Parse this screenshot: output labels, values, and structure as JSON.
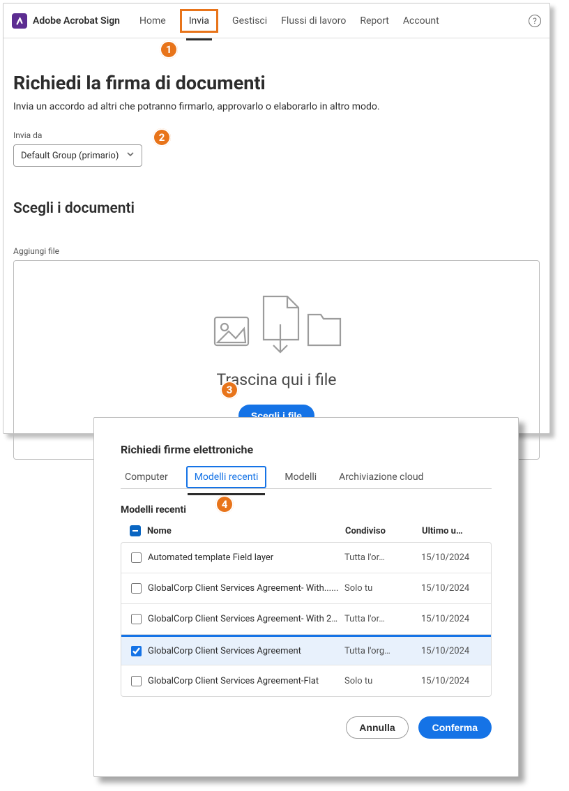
{
  "brand": "Adobe Acrobat Sign",
  "nav": {
    "items": [
      {
        "label": "Home"
      },
      {
        "label": "Invia"
      },
      {
        "label": "Gestisci"
      },
      {
        "label": "Flussi di lavoro"
      },
      {
        "label": "Report"
      },
      {
        "label": "Account"
      }
    ],
    "active_index": 1
  },
  "page": {
    "title": "Richiedi la firma di documenti",
    "subtitle": "Invia un accordo ad altri che potranno firmarlo, approvarlo o elaborarlo in altro modo.",
    "send_from_label": "Invia da",
    "send_from_value": "Default Group (primario)",
    "section_title": "Scegli i documenti",
    "add_files_label": "Aggiungi file",
    "drop_text": "Trascina qui i file",
    "choose_button": "Scegli i file"
  },
  "callouts": {
    "c1": "1",
    "c2": "2",
    "c3": "3",
    "c4": "4"
  },
  "modal": {
    "title": "Richiedi firme elettroniche",
    "tabs": [
      {
        "label": "Computer"
      },
      {
        "label": "Modelli recenti"
      },
      {
        "label": "Modelli"
      },
      {
        "label": "Archiviazione cloud"
      }
    ],
    "active_tab": 1,
    "section": "Modelli recenti",
    "columns": {
      "name": "Nome",
      "shared": "Condiviso",
      "last": "Ultimo u…"
    },
    "rows": [
      {
        "checked": false,
        "name": "Automated template Field layer",
        "shared": "Tutta l'or…",
        "date": "15/10/2024"
      },
      {
        "checked": false,
        "name": "GlobalCorp Client Services Agreement- With......",
        "shared": "Solo tu",
        "date": "15/10/2024"
      },
      {
        "checked": false,
        "name": "GlobalCorp Client Services Agreement- With 2......",
        "shared": "Tutta l'or…",
        "date": "15/10/2024"
      },
      {
        "checked": true,
        "name": "GlobalCorp Client Services Agreement",
        "shared": "Tutta l'org…",
        "date": "15/10/2024"
      },
      {
        "checked": false,
        "name": "GlobalCorp Client Services Agreement-Flat",
        "shared": "Solo tu",
        "date": "15/10/2024"
      }
    ],
    "cancel": "Annulla",
    "confirm": "Conferma"
  }
}
